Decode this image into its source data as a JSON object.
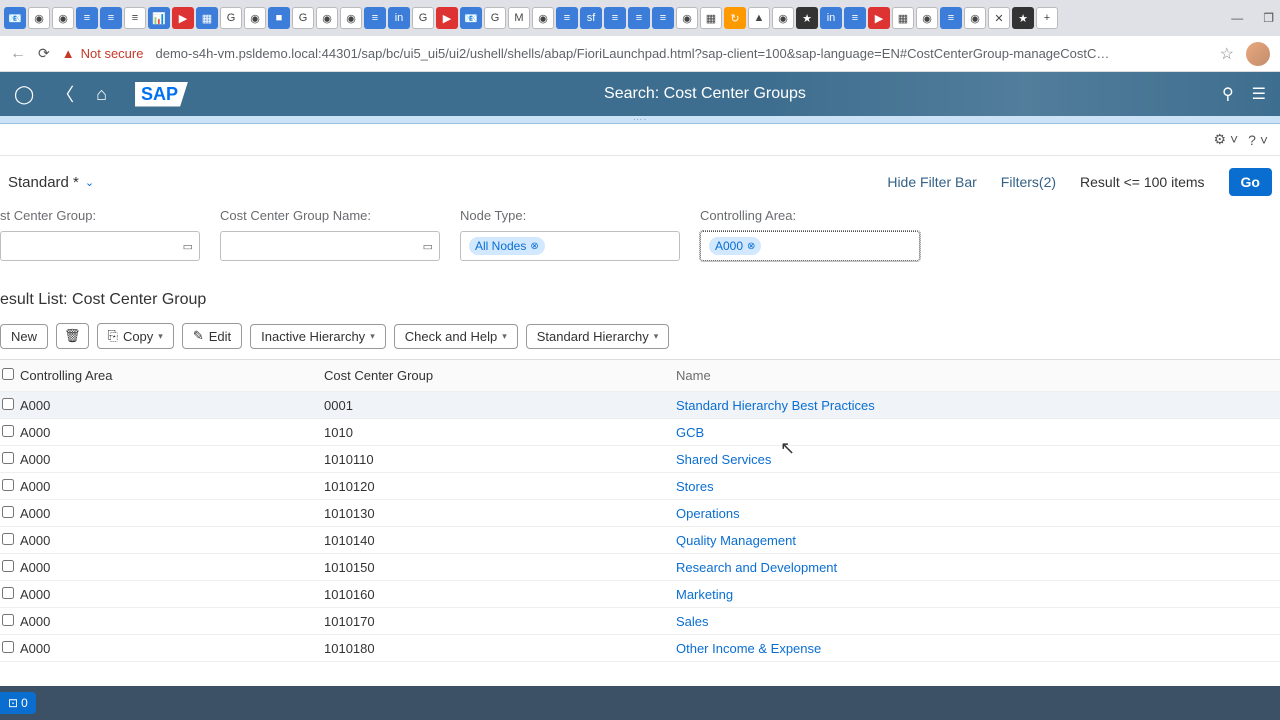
{
  "browser": {
    "not_secure_label": "Not secure",
    "url": "demo-s4h-vm.psldemo.local:44301/sap/bc/ui5_ui5/ui2/ushell/shells/abap/FioriLaunchpad.html?sap-client=100&sap-language=EN#CostCenterGroup-manageCostC…"
  },
  "sap_header": {
    "title": "Search: Cost Center Groups",
    "logo": "SAP"
  },
  "filter_bar": {
    "variant_label": "Standard *",
    "hide_filter_label": "Hide Filter Bar",
    "filters_label": "Filters(2)",
    "result_label": "Result <= 100 items",
    "go_label": "Go"
  },
  "filters": {
    "cost_center_group": {
      "label": "st Center Group:"
    },
    "cost_center_group_name": {
      "label": "Cost Center Group Name:"
    },
    "node_type": {
      "label": "Node Type:",
      "token": "All Nodes"
    },
    "controlling_area": {
      "label": "Controlling Area:",
      "token": "A000"
    }
  },
  "result_list": {
    "title": "esult List: Cost Center Group",
    "toolbar": {
      "new": "New",
      "copy": "Copy",
      "edit": "Edit",
      "inactive": "Inactive Hierarchy",
      "check": "Check and Help",
      "standard": "Standard Hierarchy"
    },
    "columns": {
      "controlling_area": "Controlling Area",
      "group": "Cost Center Group",
      "name": "Name"
    },
    "rows": [
      {
        "ca": "A000",
        "group": "0001",
        "name": "Standard Hierarchy Best Practices"
      },
      {
        "ca": "A000",
        "group": "1010",
        "name": "GCB"
      },
      {
        "ca": "A000",
        "group": "1010110",
        "name": "Shared Services"
      },
      {
        "ca": "A000",
        "group": "1010120",
        "name": "Stores"
      },
      {
        "ca": "A000",
        "group": "1010130",
        "name": "Operations"
      },
      {
        "ca": "A000",
        "group": "1010140",
        "name": "Quality Management"
      },
      {
        "ca": "A000",
        "group": "1010150",
        "name": "Research and Development"
      },
      {
        "ca": "A000",
        "group": "1010160",
        "name": "Marketing"
      },
      {
        "ca": "A000",
        "group": "1010170",
        "name": "Sales"
      },
      {
        "ca": "A000",
        "group": "1010180",
        "name": "Other Income & Expense"
      }
    ]
  },
  "footer": {
    "badge_count": "0"
  }
}
